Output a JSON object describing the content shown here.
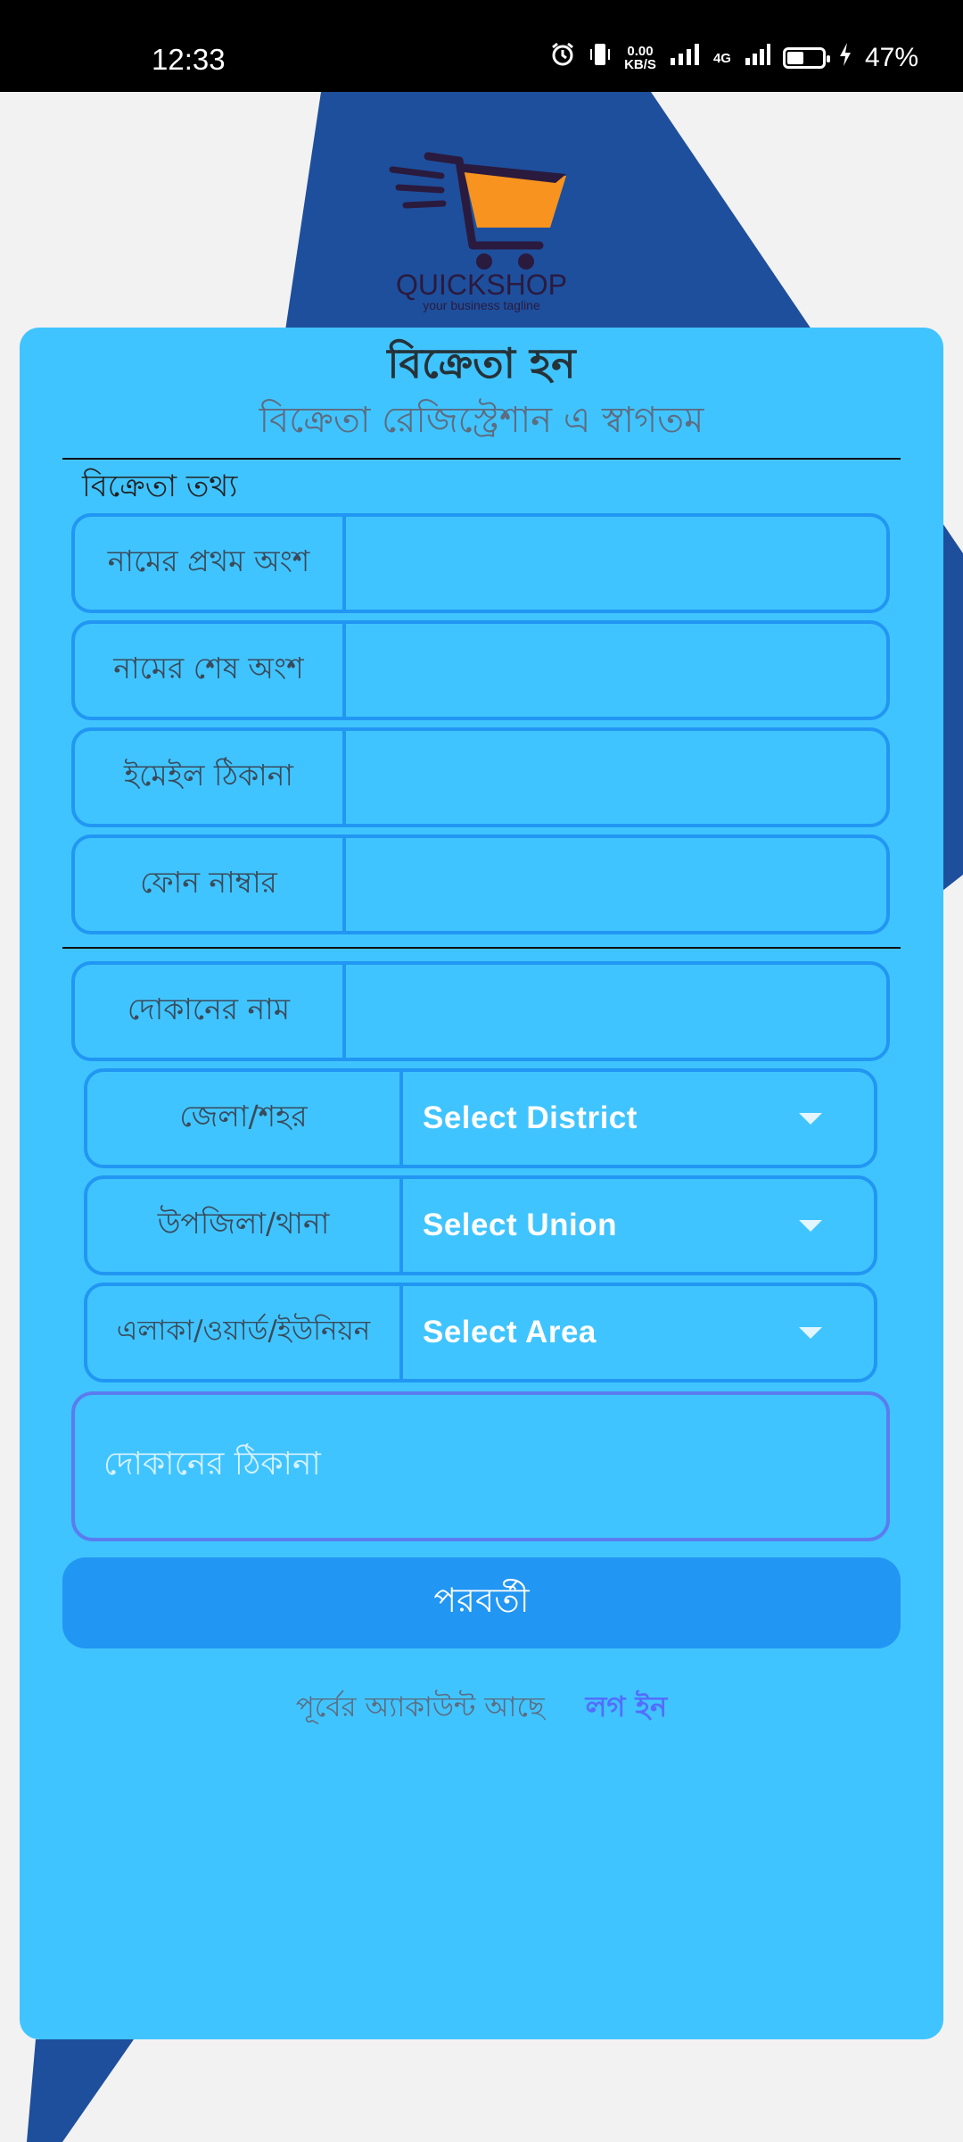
{
  "status_bar": {
    "time": "12:33",
    "net_speed_value": "0.00",
    "net_speed_unit": "KB/S",
    "network_type": "4G",
    "battery_percent": "47%"
  },
  "logo": {
    "brand": "QUICKSHOP",
    "tagline": "your business tagline"
  },
  "form": {
    "title": "বিক্রেতা হন",
    "subtitle": "বিক্রেতা রেজিস্ট্রেশান এ স্বাগতম",
    "section_label": "বিক্রেতা তথ্য",
    "first_name_label": "নামের প্রথম অংশ",
    "last_name_label": "নামের শেষ অংশ",
    "email_label": "ইমেইল ঠিকানা",
    "phone_label": "ফোন নাম্বার",
    "shop_name_label": "দোকানের নাম",
    "district_label": "জেলা/শহর",
    "district_value": "Select District",
    "union_label": "উপজিলা/থানা",
    "union_value": "Select Union",
    "area_label": "এলাকা/ওয়ার্ড/ইউনিয়ন",
    "area_value": "Select Area",
    "shop_address_placeholder": "দোকানের ঠিকানা",
    "next_button": "পরবর্তী",
    "have_account_text": "পূর্বের অ্যাকাউন্ট আছে",
    "login_link": "লগ ইন"
  },
  "colors": {
    "card": "#40c4ff",
    "border": "#2196f3",
    "button": "#2196f3",
    "bg_shape": "#1e4f9c",
    "logo_cart": "#f7931e"
  }
}
